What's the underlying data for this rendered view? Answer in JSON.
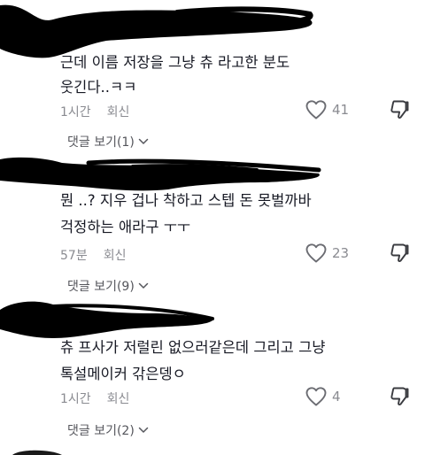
{
  "comments": [
    {
      "text_line1": "근데 이름 저장을 그냥 츄 라고한 분도",
      "text_line2": "웃긴다..ㅋㅋ",
      "time": "1시간",
      "reply_label": "회신",
      "likes": "41",
      "replies_label": "댓글 보기(1)"
    },
    {
      "text_line1": "뭔 ..? 지우 겁나 착하고 스텝 돈 못벌까바",
      "text_line2": "걱정하는 애라구 ㅜㅜ",
      "time": "57분",
      "reply_label": "회신",
      "likes": "23",
      "replies_label": "댓글 보기(9)"
    },
    {
      "text_line1": "츄 프사가 저럴린 없으러같은데 그리고 그냥",
      "text_line2": "톡설메이커 갂은뎅ㅇ",
      "time": "1시간",
      "reply_label": "회신",
      "likes": "4",
      "replies_label": "댓글 보기(2)"
    }
  ],
  "icons": {
    "like": "heart-outline-icon",
    "dislike": "thumbs-down-icon",
    "expand": "chevron-down-icon",
    "redaction": "black-scribble-redaction"
  },
  "colors": {
    "text": "#161823",
    "muted": "#8a8b91",
    "redaction": "#000000"
  }
}
